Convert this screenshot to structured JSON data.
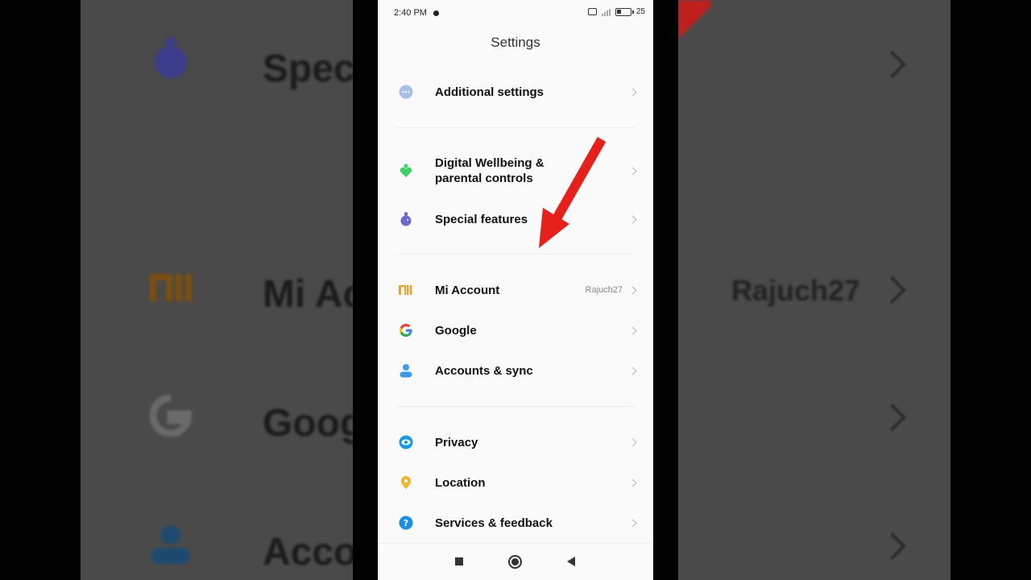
{
  "status_bar": {
    "time": "2:40 PM",
    "battery": "25"
  },
  "header": {
    "title": "Settings"
  },
  "items": [
    {
      "label": "Additional settings",
      "value": "",
      "icon": "more-dots-icon",
      "color": "#9ab7e6"
    },
    {
      "label": "Digital Wellbeing & parental controls",
      "value": "",
      "icon": "wellbeing-icon",
      "color": "#3ccf6a"
    },
    {
      "label": "Special features",
      "value": "",
      "icon": "flask-icon",
      "color": "#6a6ad4"
    },
    {
      "label": "Mi Account",
      "value": "Rajuch27",
      "icon": "mi-logo-icon",
      "color": "#f0a030"
    },
    {
      "label": "Google",
      "value": "",
      "icon": "google-icon",
      "color": "#4285f4"
    },
    {
      "label": "Accounts & sync",
      "value": "",
      "icon": "person-icon",
      "color": "#3a9be8"
    },
    {
      "label": "Privacy",
      "value": "",
      "icon": "eye-icon",
      "color": "#1a9be0"
    },
    {
      "label": "Location",
      "value": "",
      "icon": "location-pin-icon",
      "color": "#f3b62c"
    },
    {
      "label": "Services & feedback",
      "value": "",
      "icon": "help-icon",
      "color": "#1a8fe6"
    }
  ],
  "background_zoom": {
    "left": [
      "Spec",
      "Mi Ac",
      "Goog",
      "Acco"
    ],
    "right_value": "Rajuch27"
  },
  "annotation": {
    "arrow_color": "#e8201c"
  }
}
